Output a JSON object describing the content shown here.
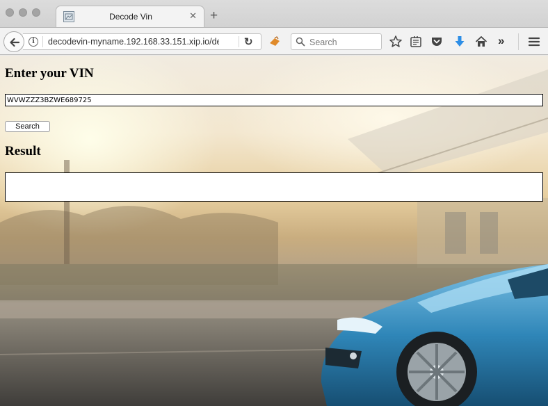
{
  "browser": {
    "tab_title": "Decode Vin",
    "tab_close": "✕",
    "new_tab": "+",
    "url": "decodevin-myname.192.168.33.151.xip.io/de",
    "search_placeholder": "Search",
    "overflow_label": "»"
  },
  "form": {
    "heading": "Enter your VIN",
    "vin_value": "WVWZZZ3BZWE689725",
    "search_button": "Search"
  },
  "result": {
    "heading": "Result",
    "value": ""
  },
  "icons": {
    "download_color": "#2d8ee6",
    "car_color": "#2f86b8"
  }
}
